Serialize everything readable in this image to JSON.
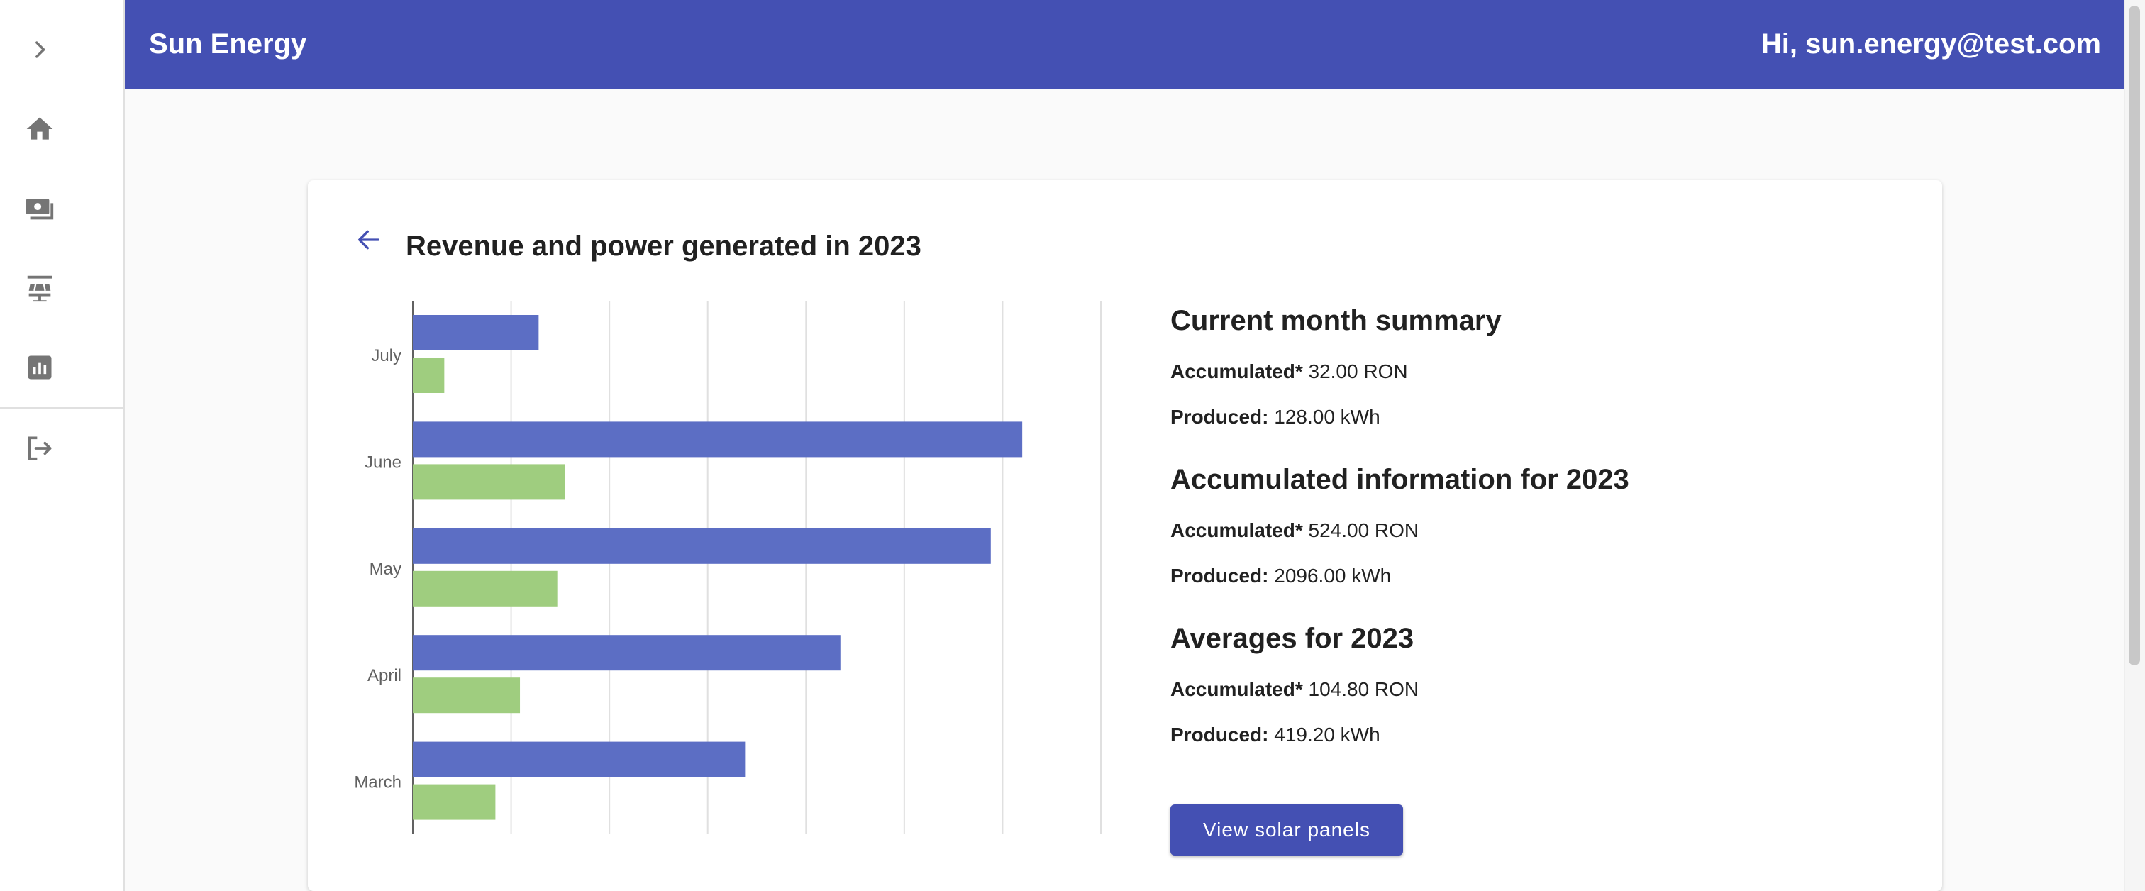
{
  "header": {
    "app_title": "Sun Energy",
    "greeting": "Hi, sun.energy@test.com"
  },
  "sidebar": {
    "items": [
      {
        "icon": "chevron-right-icon"
      },
      {
        "icon": "home-icon"
      },
      {
        "icon": "payments-icon"
      },
      {
        "icon": "solar-panel-icon"
      },
      {
        "icon": "analytics-icon"
      },
      {
        "icon": "logout-icon"
      }
    ]
  },
  "main": {
    "title": "Revenue and power generated in 2023",
    "sections": [
      {
        "heading": "Current month summary",
        "accumulated_label": "Accumulated*",
        "accumulated_value": "32.00 RON",
        "produced_label": "Produced:",
        "produced_value": "128.00 kWh"
      },
      {
        "heading": "Accumulated information for 2023",
        "accumulated_label": "Accumulated*",
        "accumulated_value": "524.00 RON",
        "produced_label": "Produced:",
        "produced_value": "2096.00 kWh"
      },
      {
        "heading": "Averages for 2023",
        "accumulated_label": "Accumulated*",
        "accumulated_value": "104.80 RON",
        "produced_label": "Produced:",
        "produced_value": "419.20 kWh"
      }
    ],
    "view_button_label": "View solar panels"
  },
  "colors": {
    "primary": "#4450b3",
    "series_produced": "#5c6ec4",
    "series_revenue": "#9fcd7f"
  },
  "chart_data": {
    "type": "bar",
    "orientation": "horizontal",
    "categories": [
      "July",
      "June",
      "May",
      "April",
      "March"
    ],
    "series": [
      {
        "values": [
          128,
          620,
          588,
          435,
          338
        ]
      },
      {
        "values": [
          32,
          155,
          147,
          109,
          84
        ]
      }
    ],
    "xlim": [
      0,
      700
    ],
    "grid": true,
    "legend": "none"
  }
}
